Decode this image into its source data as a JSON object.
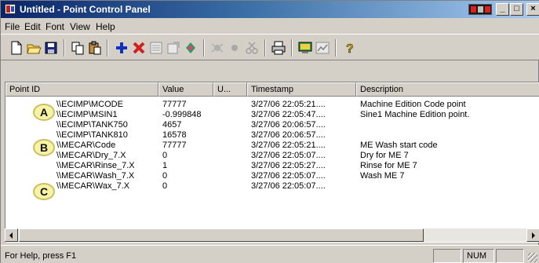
{
  "window": {
    "title": "Untitled - Point Control Panel",
    "title_buttons": {
      "minimize": "_",
      "maximize": "□",
      "close": "×"
    }
  },
  "menu": [
    "File",
    "Edit",
    "Font",
    "View",
    "Help"
  ],
  "toolbar": {
    "icons": [
      "new-icon",
      "open-icon",
      "save-icon",
      "copy-icon",
      "paste-icon",
      "add-point-icon",
      "delete-point-icon",
      "list-icon",
      "properties-icon",
      "connect-icon",
      "bug-icon",
      "record-icon",
      "cut-icon",
      "print-icon",
      "monitor-icon",
      "chart-icon",
      "help-icon"
    ]
  },
  "list": {
    "columns": [
      "Point ID",
      "Value",
      "U...",
      "Timestamp",
      "Description"
    ],
    "rows": [
      {
        "id": "\\\\ECIMP\\MCODE",
        "value": "77777",
        "timestamp": "3/27/06  22:05:21....",
        "description": "Machine Edition Code point"
      },
      {
        "id": "\\\\ECIMP\\MSIN1",
        "value": "-0.999848",
        "timestamp": "3/27/06  22:05:47....",
        "description": "Sine1 Machine Edition point."
      },
      {
        "id": "\\\\ECIMP\\TANK750",
        "value": "4657",
        "timestamp": "3/27/06  20:06:57....",
        "description": ""
      },
      {
        "id": "\\\\ECIMP\\TANK810",
        "value": "16578",
        "timestamp": "3/27/06  20:06:57....",
        "description": ""
      },
      {
        "id": "\\\\MECAR\\Code",
        "value": "77777",
        "timestamp": "3/27/06  22:05:21....",
        "description": "ME Wash start code"
      },
      {
        "id": "\\\\MECAR\\Dry_7.X",
        "value": "0",
        "timestamp": "3/27/06  22:05:07....",
        "description": "Dry for ME 7"
      },
      {
        "id": "\\\\MECAR\\Rinse_7.X",
        "value": "1",
        "timestamp": "3/27/06  22:05:27....",
        "description": "Rinse for ME 7"
      },
      {
        "id": "\\\\MECAR\\Wash_7.X",
        "value": "0",
        "timestamp": "3/27/06  22:05:07....",
        "description": "Wash ME 7"
      },
      {
        "id": "\\\\MECAR\\Wax_7.X",
        "value": "0",
        "timestamp": "3/27/06  22:05:07....",
        "description": ""
      }
    ]
  },
  "callouts": [
    "A",
    "B",
    "C"
  ],
  "status": {
    "text": "For Help, press F1",
    "num": "NUM"
  },
  "colors": {
    "title_start": "#0a246a",
    "title_end": "#a6caf0",
    "callout_fill": "#f7f3a6",
    "face": "#d4d0c8"
  }
}
